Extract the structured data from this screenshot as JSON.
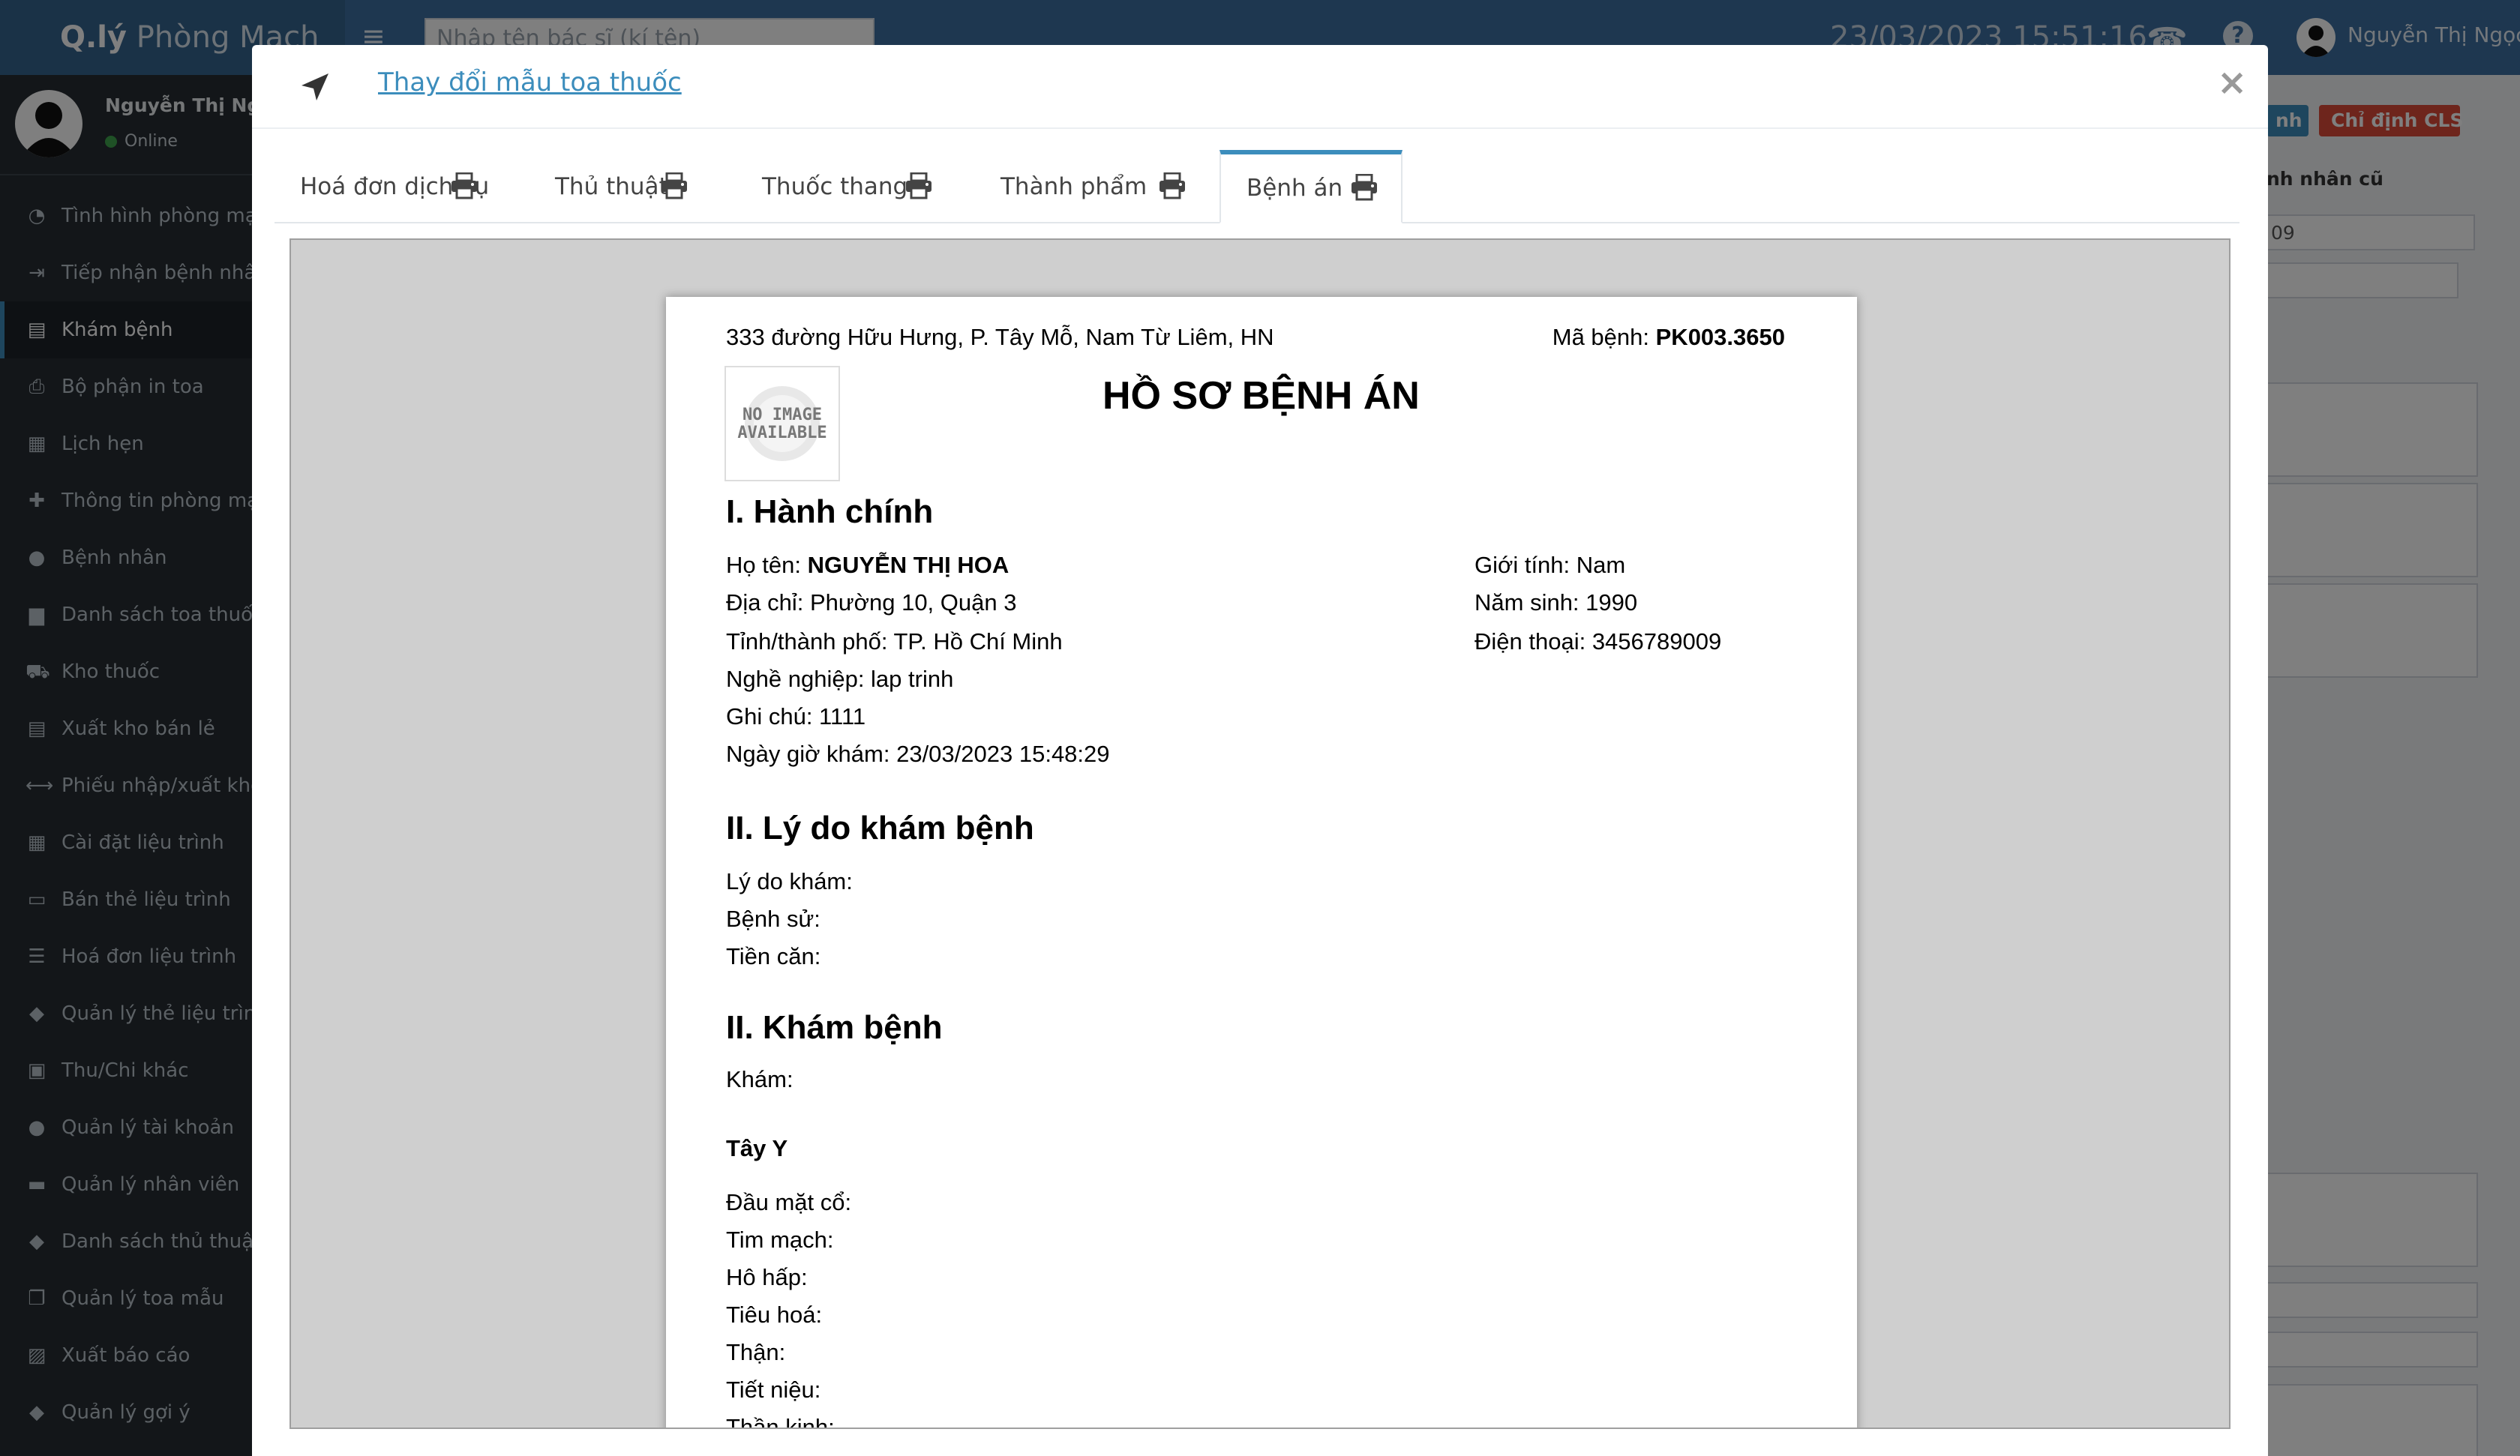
{
  "app": {
    "brand_bold": "Q.lý",
    "brand_light": "Phòng Mạch",
    "search_placeholder": "Nhập tên bác sĩ (kí tên)",
    "datetime": "23/03/2023   15:51:16",
    "user_name": "Nguyễn Thị Ngọc",
    "user_status": "Online"
  },
  "sidebar": {
    "items": [
      {
        "label": "Tình hình phòng mạch",
        "icon": "pie-chart-icon",
        "glyph": "◔"
      },
      {
        "label": "Tiếp nhận bệnh nhân",
        "icon": "sign-in-icon",
        "glyph": "⇥"
      },
      {
        "label": "Khám bệnh",
        "icon": "clipboard-icon",
        "glyph": "▤"
      },
      {
        "label": "Bộ phận in toa",
        "icon": "print-icon",
        "glyph": "⎙"
      },
      {
        "label": "Lịch hẹn",
        "icon": "calendar-icon",
        "glyph": "▦"
      },
      {
        "label": "Thông tin phòng mạch",
        "icon": "plus-icon",
        "glyph": "✚"
      },
      {
        "label": "Bệnh nhân",
        "icon": "user-icon",
        "glyph": "●"
      },
      {
        "label": "Danh sách toa thuốc",
        "icon": "file-icon",
        "glyph": "▆"
      },
      {
        "label": "Kho thuốc",
        "icon": "truck-icon",
        "glyph": "⛟"
      },
      {
        "label": "Xuất kho bán lẻ",
        "icon": "clipboard-list-icon",
        "glyph": "▤"
      },
      {
        "label": "Phiếu nhập/xuất kho",
        "icon": "arrows-h-icon",
        "glyph": "⟷"
      },
      {
        "label": "Cài đặt liệu trình",
        "icon": "table-icon",
        "glyph": "▦"
      },
      {
        "label": "Bán thẻ liệu trình",
        "icon": "credit-card-icon",
        "glyph": "▭"
      },
      {
        "label": "Hoá đơn liệu trình",
        "icon": "list-icon",
        "glyph": "☰"
      },
      {
        "label": "Quản lý thẻ liệu trình",
        "icon": "tags-icon",
        "glyph": "◆"
      },
      {
        "label": "Thu/Chi khác",
        "icon": "money-icon",
        "glyph": "▣"
      },
      {
        "label": "Quản lý tài khoản",
        "icon": "users-icon",
        "glyph": "●"
      },
      {
        "label": "Quản lý nhân viên",
        "icon": "briefcase-icon",
        "glyph": "▬"
      },
      {
        "label": "Danh sách thủ thuật",
        "icon": "tags-icon",
        "glyph": "◆"
      },
      {
        "label": "Quản lý toa mẫu",
        "icon": "copy-icon",
        "glyph": "❐"
      },
      {
        "label": "Xuất báo cáo",
        "icon": "file-excel-icon",
        "glyph": "▨"
      },
      {
        "label": "Quản lý gợi ý",
        "icon": "tags-icon",
        "glyph": "◆"
      }
    ],
    "active_index": 2
  },
  "background": {
    "btn_blue": "nh",
    "btn_red": "Chỉ định CLS",
    "label": "nh nhân cũ",
    "input_value": "09"
  },
  "modal": {
    "header_link": "Thay đổi mẫu toa thuốc",
    "close": "×",
    "tabs": [
      {
        "label": "Hoá đơn dịch vụ",
        "icon": "print-icon"
      },
      {
        "label": "Thủ thuật",
        "icon": "print-icon"
      },
      {
        "label": "Thuốc thang",
        "icon": "print-icon"
      },
      {
        "label": "Thành phẩm",
        "icon": "print-icon"
      },
      {
        "label": "Bệnh án",
        "icon": "print-icon"
      }
    ],
    "active_tab": 4
  },
  "document": {
    "clinic_address": "333 đường Hữu Hưng, P. Tây Mỗ, Nam Từ Liêm, HN",
    "record_code_label": "Mã bệnh: ",
    "record_code": "PK003.3650",
    "logo_text_1": "NO IMAGE",
    "logo_text_2": "AVAILABLE",
    "title": "HỒ SƠ BỆNH ÁN",
    "section1": "I. Hành chính",
    "name_label": "Họ tên: ",
    "name": "NGUYỄN THỊ HOA",
    "address": "Địa chỉ: Phường 10, Quận 3",
    "province": "Tỉnh/thành phố: TP. Hồ Chí Minh",
    "occupation": "Nghề nghiệp: lap trinh",
    "note": "Ghi chú: 1111",
    "exam_time": "Ngày giờ khám: 23/03/2023 15:48:29",
    "gender": "Giới tính: Nam",
    "birth_year": "Năm sinh: 1990",
    "phone": "Điện thoại: 3456789009",
    "section2": "II. Lý do khám bệnh",
    "reason": "Lý do khám:",
    "history": "Bệnh sử:",
    "past_history": "Tiền căn:",
    "section3": "II. Khám bệnh",
    "exam": "Khám:",
    "western": "Tây Y",
    "head_neck": "Đầu mặt cổ:",
    "cardio": "Tim mạch:",
    "respiratory": "Hô hấp:",
    "digestive": "Tiêu hoá:",
    "kidney": "Thận:",
    "urinary": "Tiết niệu:",
    "nerve": "Thần kinh:"
  }
}
